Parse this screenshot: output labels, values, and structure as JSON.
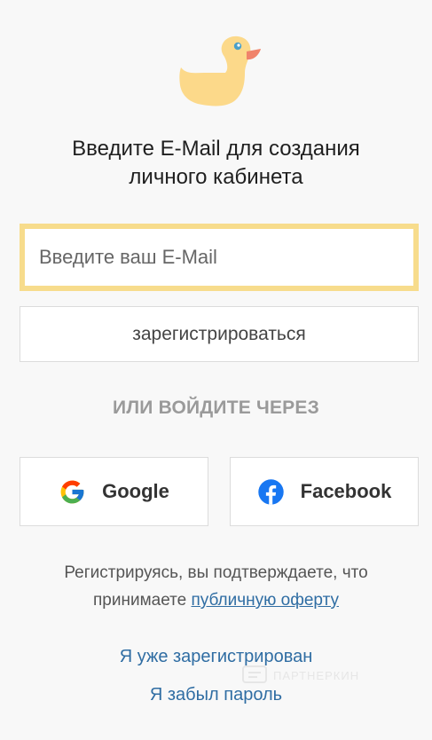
{
  "logo": {
    "icon": "duck-icon",
    "colors": {
      "body": "#fcd98a",
      "beak": "#f0836b",
      "eye": "#4a9fc9"
    }
  },
  "title": {
    "line1": "Введите E-Mail для создания",
    "line2": "личного кабинета"
  },
  "email": {
    "placeholder": "Введите ваш E-Mail",
    "value": ""
  },
  "register_button": "зарегистрироваться",
  "or_label": "ИЛИ ВОЙДИТЕ ЧЕРЕЗ",
  "social": {
    "google": {
      "label": "Google",
      "icon": "google-icon"
    },
    "facebook": {
      "label": "Facebook",
      "icon": "facebook-icon"
    }
  },
  "terms": {
    "text": "Регистрируясь, вы подтверждаете, что",
    "text2": "принимаете",
    "link": "публичную оферту"
  },
  "links": {
    "already_registered": "Я уже зарегистрирован",
    "forgot_password": "Я забыл пароль"
  },
  "watermark": "ПАРТНЕРКИН",
  "colors": {
    "accent_border": "#f7dc8c",
    "link": "#2f6da3",
    "background": "#f8f8f8"
  }
}
